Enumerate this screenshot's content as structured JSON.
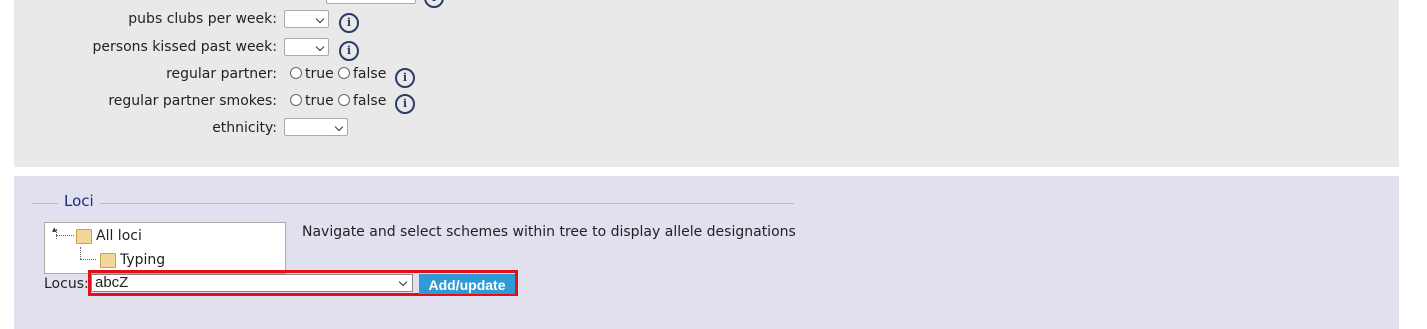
{
  "form": {
    "fields": [
      {
        "label": "pubs clubs per week:",
        "type": "select",
        "value": ""
      },
      {
        "label": "persons kissed past week:",
        "type": "select",
        "value": ""
      },
      {
        "label": "regular partner:",
        "type": "radio",
        "options": [
          "true",
          "false"
        ]
      },
      {
        "label": "regular partner smokes:",
        "type": "radio",
        "options": [
          "true",
          "false"
        ]
      },
      {
        "label": "ethnicity:",
        "type": "select",
        "value": ""
      }
    ],
    "info_glyph": "i"
  },
  "loci": {
    "legend": "Loci",
    "tree": {
      "root": "All loci",
      "child": "Typing"
    },
    "hint": "Navigate and select schemes within tree to display allele designations",
    "locus_label": "Locus:",
    "locus_value": "abcZ",
    "add_button": "Add/update"
  },
  "colors": {
    "top_panel": "#e9e9e9",
    "bottom_panel": "#e1e0ef",
    "button": "#2e9bd6",
    "highlight": "#e3101a",
    "legend": "#1b2f7a"
  }
}
